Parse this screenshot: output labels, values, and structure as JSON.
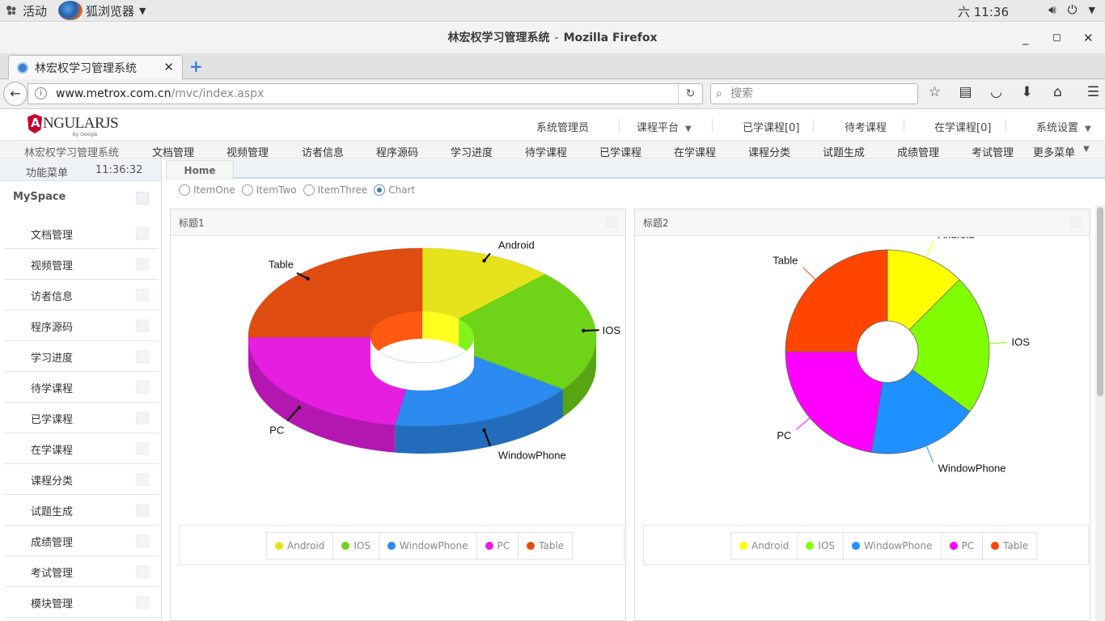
{
  "system_bar": {
    "activities": "活动",
    "app_name": "狐浏览器",
    "clock": "六 11:36"
  },
  "window": {
    "title": "林宏权学习管理系统",
    "app": "Mozilla Firefox"
  },
  "browser": {
    "tab_title": "林宏权学习管理系统",
    "url_domain": "www.metrox.com.cn",
    "url_path": "/mvc/index.aspx",
    "search_placeholder": "搜索"
  },
  "app": {
    "logo_text": "NGULARJS",
    "logo_sub": "by Google",
    "top_menu": [
      "系统管理员",
      "课程平台",
      "已学课程[0]",
      "待考课程",
      "在学课程[0]",
      "系统设置"
    ],
    "nav_menu": [
      "林宏权学习管理系统",
      "文档管理",
      "视频管理",
      "访者信息",
      "程序源码",
      "学习进度",
      "待学课程",
      "已学课程",
      "在学课程",
      "课程分类",
      "试题生成",
      "成绩管理",
      "考试管理",
      "更多菜单"
    ]
  },
  "sidebar": {
    "title": "功能菜单",
    "time": "11:36:32",
    "section": "MySpace",
    "items": [
      "文档管理",
      "视频管理",
      "访者信息",
      "程序源码",
      "学习进度",
      "待学课程",
      "已学课程",
      "在学课程",
      "课程分类",
      "试题生成",
      "成绩管理",
      "考试管理",
      "模块管理"
    ]
  },
  "main": {
    "tab": "Home",
    "radios": [
      {
        "label": "ItemOne",
        "checked": false
      },
      {
        "label": "ItemTwo",
        "checked": false
      },
      {
        "label": "ItemThree",
        "checked": false
      },
      {
        "label": "Chart",
        "checked": true
      }
    ],
    "panel1_title": "标题1",
    "panel2_title": "标题2"
  },
  "chart_data": [
    {
      "type": "pie",
      "variant": "3d-donut",
      "categories": [
        "Android",
        "IOS",
        "WindowPhone",
        "PC",
        "Table"
      ],
      "values": [
        12.5,
        22.5,
        17.5,
        22.5,
        25.0
      ],
      "colors": [
        "#e6e21c",
        "#6fd318",
        "#2c8bf0",
        "#e61ee0",
        "#e04d10"
      ],
      "legend": "bottom"
    },
    {
      "type": "pie",
      "variant": "donut",
      "categories": [
        "Android",
        "IOS",
        "WindowPhone",
        "PC",
        "Table"
      ],
      "values": [
        12.5,
        22.5,
        17.5,
        22.5,
        25.0
      ],
      "colors": [
        "#ffff00",
        "#7fff00",
        "#1e90ff",
        "#ff00ff",
        "#ff4500"
      ],
      "legend": "bottom"
    }
  ]
}
